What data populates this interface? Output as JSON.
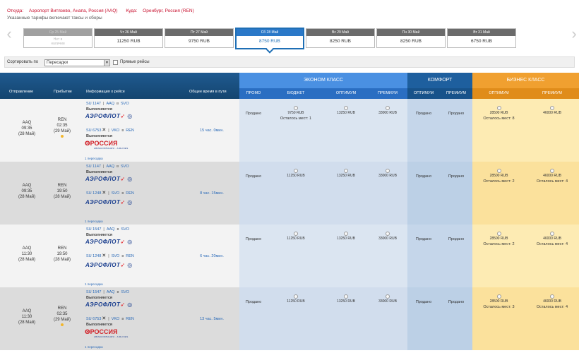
{
  "route": {
    "from_label": "Откуда:",
    "from_value": "Аэропорт Витязево, Анапа, Россия (AAQ)",
    "to_label": "Куда:",
    "to_value": "Оренбург, Россия (REN)",
    "note": "Указанные тарифы включают таксы и сборы"
  },
  "dates": [
    {
      "day": "Ср 25 Май",
      "price": "Нет в наличии",
      "state": "na"
    },
    {
      "day": "Чт 26 Май",
      "price": "11250 RUB",
      "state": ""
    },
    {
      "day": "Пт 27 Май",
      "price": "9750 RUB",
      "state": ""
    },
    {
      "day": "Сб 28 Май",
      "price": "8750 RUB",
      "state": "sel"
    },
    {
      "day": "Вс 29 Май",
      "price": "8250 RUB",
      "state": ""
    },
    {
      "day": "Пн 30 Май",
      "price": "8250 RUB",
      "state": ""
    },
    {
      "day": "Вт 31 Май",
      "price": "6750 RUB",
      "state": ""
    }
  ],
  "sort": {
    "label": "Сортировать по",
    "value": "Пересадки",
    "direct_label": "Прямые рейсы"
  },
  "header": {
    "departure": "Отправление",
    "arrival": "Прибытие",
    "info": "Информация о рейсе",
    "total_time": "Общее время в пути",
    "economy": "ЭКОНОМ КЛАСС",
    "comfort": "КОМФОРТ",
    "business": "БИЗНЕС КЛАСС",
    "sub": {
      "promo": "ПРОМО",
      "budget": "БЮДЖЕТ",
      "optimum": "ОПТИМУМ",
      "premium": "ПРЕМИУМ",
      "c_optimum": "ОПТИМУМ",
      "c_premium": "ПРЕМИУМ",
      "b_optimum": "ОПТИМУМ",
      "b_premium": "ПРЕМИУМ"
    }
  },
  "flights": [
    {
      "dep_code": "AAQ",
      "dep_time": "09:35",
      "dep_date": "(28 Май)",
      "arr_code": "REN",
      "arr_time": "02:35",
      "arr_date": "(29 Май)",
      "seg1": {
        "num": "SU 1147",
        "from": "AAQ",
        "to": "SVO",
        "status": "Выполняется",
        "logo": "АЭРОФЛОТ"
      },
      "seg2": {
        "num": "SU 6753",
        "from": "VKO",
        "to": "REN",
        "status": "Выполняется",
        "logo": "РОССИЯ",
        "logo_sub": "АВИАКОМПАНИЯ · AIRLINES"
      },
      "transfer": "1 пересадка",
      "duration": "15 час. 0мин.",
      "promo": "Продано",
      "budget": "9750 RUB",
      "budget_seats": "Осталось мест: 1",
      "optimum": "13250 RUB",
      "premium": "33000 RUB",
      "c_optimum": "Продано",
      "c_premium": "Продано",
      "b_optimum": "28500 RUB",
      "b_optimum_seats": "Осталось мест: 8",
      "b_premium": "46000 RUB",
      "b_premium_seats": ""
    },
    {
      "dep_code": "AAQ",
      "dep_time": "09:35",
      "dep_date": "(28 Май)",
      "arr_code": "REN",
      "arr_time": "19:50",
      "arr_date": "(28 Май)",
      "seg1": {
        "num": "SU 1147",
        "from": "AAQ",
        "to": "SVO",
        "status": "Выполняется",
        "logo": "АЭРОФЛОТ"
      },
      "seg2": {
        "num": "SU 1248",
        "from": "SVO",
        "to": "REN",
        "status": "",
        "logo": "АЭРОФЛОТ",
        "logo_sub": ""
      },
      "transfer": "1 пересадка",
      "duration": "8 час. 15мин.",
      "promo": "Продано",
      "budget": "11250 RUB",
      "budget_seats": "",
      "optimum": "13250 RUB",
      "premium": "33000 RUB",
      "c_optimum": "Продано",
      "c_premium": "Продано",
      "b_optimum": "28500 RUB",
      "b_optimum_seats": "Осталось мест: 2",
      "b_premium": "46000 RUB",
      "b_premium_seats": "Осталось мест: 4"
    },
    {
      "dep_code": "AAQ",
      "dep_time": "11:30",
      "dep_date": "(28 Май)",
      "arr_code": "REN",
      "arr_time": "19:50",
      "arr_date": "(28 Май)",
      "seg1": {
        "num": "SU 1547",
        "from": "AAQ",
        "to": "SVO",
        "status": "Выполняется",
        "logo": "АЭРОФЛОТ"
      },
      "seg2": {
        "num": "SU 1248",
        "from": "SVO",
        "to": "REN",
        "status": "",
        "logo": "АЭРОФЛОТ",
        "logo_sub": ""
      },
      "transfer": "1 пересадка",
      "duration": "6 час. 20мин.",
      "promo": "Продано",
      "budget": "11250 RUB",
      "budget_seats": "",
      "optimum": "13250 RUB",
      "premium": "33000 RUB",
      "c_optimum": "Продано",
      "c_premium": "Продано",
      "b_optimum": "28500 RUB",
      "b_optimum_seats": "Осталось мест: 2",
      "b_premium": "46000 RUB",
      "b_premium_seats": "Осталось мест: 4"
    },
    {
      "dep_code": "AAQ",
      "dep_time": "11:30",
      "dep_date": "(28 Май)",
      "arr_code": "REN",
      "arr_time": "02:35",
      "arr_date": "(29 Май)",
      "seg1": {
        "num": "SU 1547",
        "from": "AAQ",
        "to": "SVO",
        "status": "Выполняется",
        "logo": "АЭРОФЛОТ"
      },
      "seg2": {
        "num": "SU 6753",
        "from": "VKO",
        "to": "REN",
        "status": "Выполняется",
        "logo": "РОССИЯ",
        "logo_sub": "АВИАКОМПАНИЯ · AIRLINES"
      },
      "transfer": "1 пересадка",
      "duration": "13 час. 5мин.",
      "promo": "Продано",
      "budget": "11250 RUB",
      "budget_seats": "",
      "optimum": "13250 RUB",
      "premium": "33000 RUB",
      "c_optimum": "Продано",
      "c_premium": "Продано",
      "b_optimum": "28500 RUB",
      "b_optimum_seats": "Осталось мест: 3",
      "b_premium": "46000 RUB",
      "b_premium_seats": "Осталось мест: 4"
    }
  ],
  "colors": {
    "header_dark": "#1f5a90",
    "economy_header": "#4a90e2",
    "comfort_header": "#1e5f9e",
    "business_header": "#f0a030",
    "accent_red": "#c8102e"
  },
  "icons": {
    "prev": "chevron-left-icon",
    "next": "chevron-right-icon",
    "dropdown": "chevron-down-icon"
  }
}
